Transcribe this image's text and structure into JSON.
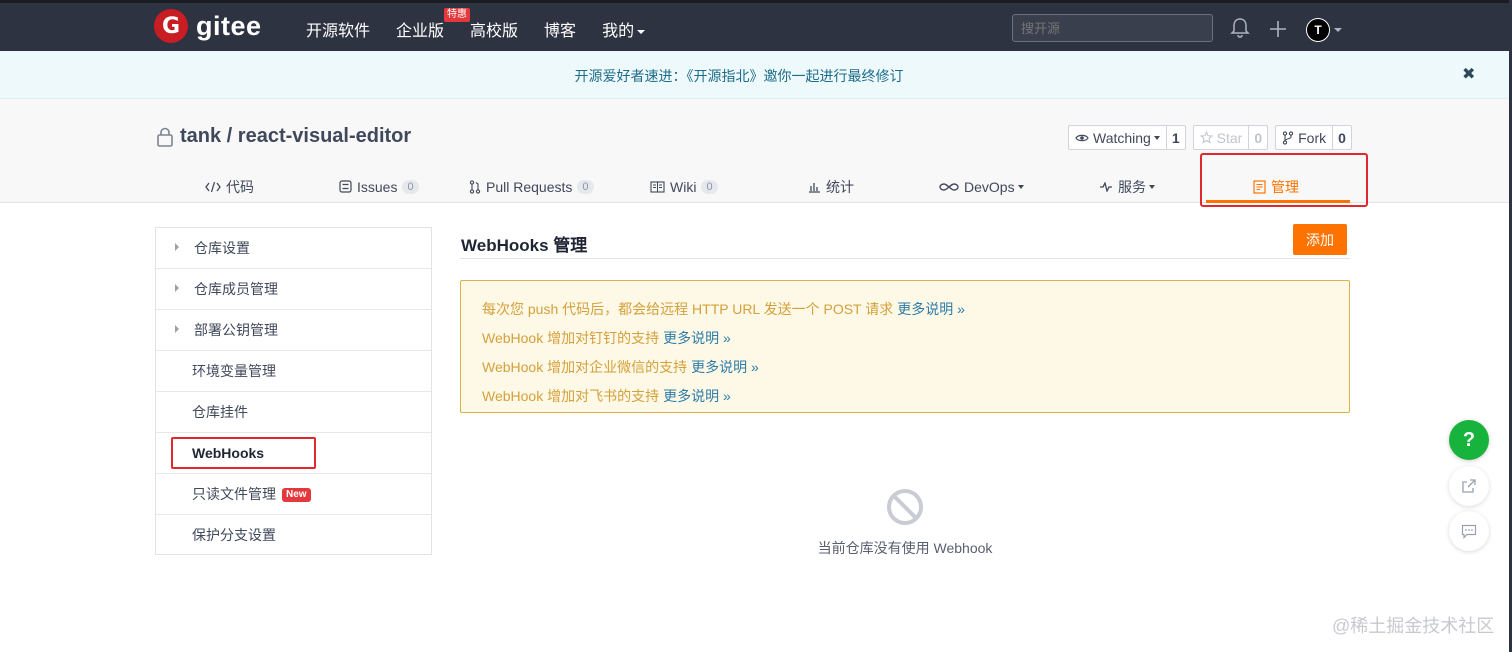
{
  "nav": {
    "logo_mark": "G",
    "logo_text": "gitee",
    "links": [
      "开源软件",
      "企业版",
      "高校版",
      "博客",
      "我的"
    ],
    "badge": "特惠",
    "search_placeholder": "搜开源",
    "avatar_letter": "T"
  },
  "announcement": {
    "text": "开源爱好者速进：《开源指北》邀你一起进行最终修订",
    "close": "✖"
  },
  "repo": {
    "title": "tank / react-visual-editor",
    "watching_label": "Watching",
    "watching_count": "1",
    "star_label": "Star",
    "star_count": "0",
    "fork_label": "Fork",
    "fork_count": "0"
  },
  "tabs": [
    {
      "label": "代码",
      "icon": "code-icon"
    },
    {
      "label": "Issues",
      "count": "0",
      "icon": "issues-icon"
    },
    {
      "label": "Pull Requests",
      "count": "0",
      "icon": "pull-request-icon"
    },
    {
      "label": "Wiki",
      "count": "0",
      "icon": "wiki-icon"
    },
    {
      "label": "统计",
      "icon": "stats-icon"
    },
    {
      "label": "DevOps",
      "icon": "devops-icon"
    },
    {
      "label": "服务",
      "icon": "service-icon"
    },
    {
      "label": "管理",
      "icon": "manage-icon",
      "active": true
    }
  ],
  "sidebar": {
    "items": [
      {
        "label": "仓库设置"
      },
      {
        "label": "仓库成员管理"
      },
      {
        "label": "部署公钥管理"
      },
      {
        "label": "环境变量管理"
      },
      {
        "label": "仓库挂件"
      },
      {
        "label": "WebHooks"
      },
      {
        "label": "只读文件管理",
        "badge": "New"
      },
      {
        "label": "保护分支设置"
      }
    ]
  },
  "main": {
    "title": "WebHooks 管理",
    "add_button": "添加",
    "notices": [
      {
        "text": "每次您 push 代码后，都会给远程 HTTP URL 发送一个 POST 请求",
        "link": "更多说明 »"
      },
      {
        "text": "WebHook 增加对钉钉的支持",
        "link": "更多说明 »"
      },
      {
        "text": "WebHook 增加对企业微信的支持",
        "link": "更多说明 »"
      },
      {
        "text": "WebHook 增加对飞书的支持",
        "link": "更多说明 »"
      }
    ],
    "empty_text": "当前仓库没有使用 Webhook"
  },
  "floating": {
    "help": "?"
  },
  "watermark": "@稀土掘金技术社区",
  "colors": {
    "accent": "#fe7300",
    "nav_bg": "#2e3341",
    "highlight": "#e0282e",
    "notice_text": "#d4a03a",
    "link": "#2c7ba8"
  }
}
